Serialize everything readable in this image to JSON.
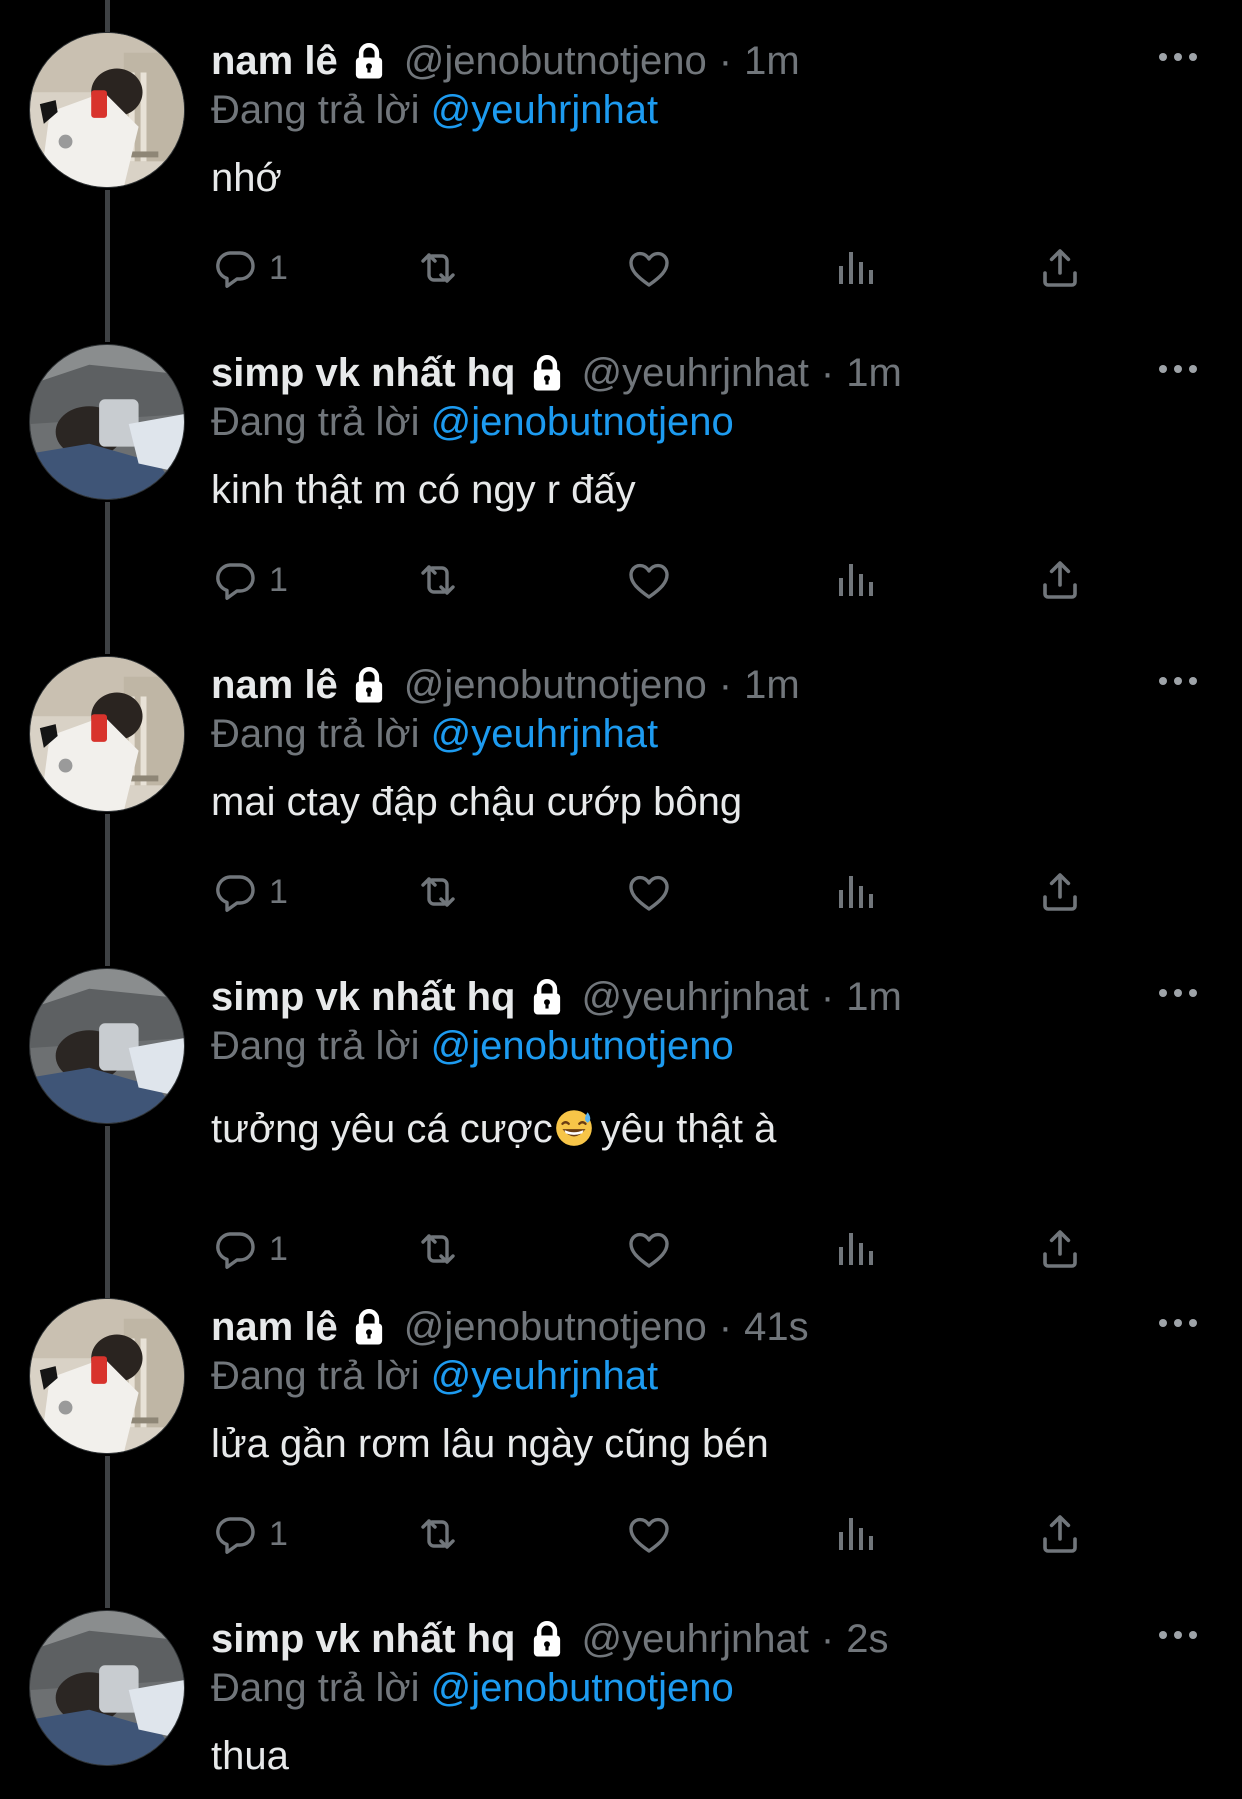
{
  "reply_prefix": "Đang trả lời",
  "tweets": [
    {
      "name": "nam lê",
      "handle": "@jenobutnotjeno",
      "separator": "·",
      "time": "1m",
      "reply_to": "@yeuhrjnhat",
      "text": "nhớ",
      "replies": "1"
    },
    {
      "name": "simp vk nhất hq",
      "handle": "@yeuhrjnhat",
      "separator": "·",
      "time": "1m",
      "reply_to": "@jenobutnotjeno",
      "text": "kinh thật m có ngy r đấy",
      "replies": "1"
    },
    {
      "name": "nam lê",
      "handle": "@jenobutnotjeno",
      "separator": "·",
      "time": "1m",
      "reply_to": "@yeuhrjnhat",
      "text": "mai ctay đập chậu cướp bông",
      "replies": "1"
    },
    {
      "name": "simp vk nhất hq",
      "handle": "@yeuhrjnhat",
      "separator": "·",
      "time": "1m",
      "reply_to": "@jenobutnotjeno",
      "text_before_emoji": "tưởng yêu cá cược",
      "emoji": "grinning-face-with-sweat",
      "text_after_emoji": "yêu thật à",
      "replies": "1"
    },
    {
      "name": "nam lê",
      "handle": "@jenobutnotjeno",
      "separator": "·",
      "time": "41s",
      "reply_to": "@yeuhrjnhat",
      "text": "lửa gần rơm lâu ngày cũng bén",
      "replies": "1"
    },
    {
      "name": "simp vk nhất hq",
      "handle": "@yeuhrjnhat",
      "separator": "·",
      "time": "2s",
      "reply_to": "@jenobutnotjeno",
      "text": "thua"
    }
  ],
  "icons": {
    "reply": "reply-icon",
    "retweet": "retweet-icon",
    "like": "like-icon",
    "views": "views-icon",
    "share": "share-icon",
    "more": "more-icon",
    "lock": "lock-icon"
  },
  "colors": {
    "background": "#000000",
    "text": "#e7e9ea",
    "secondary": "#71767b",
    "mention": "#1d9bf0",
    "thread_line": "#3e4144"
  }
}
